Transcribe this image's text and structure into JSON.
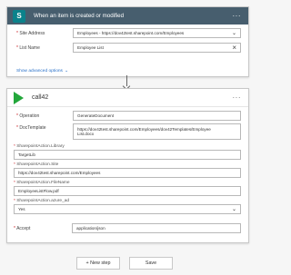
{
  "trigger": {
    "title": "When an item is created or modified",
    "more_icon": "···",
    "fields": [
      {
        "label": "Site Address",
        "value": "Employees - https://dov42test.sharepoint.com/Employees",
        "control": "chevron-down-icon"
      },
      {
        "label": "List Name",
        "value": "Employee List",
        "control": "close-icon"
      }
    ],
    "show_advanced": "Show advanced options",
    "show_advanced_chevron": "⌄"
  },
  "action": {
    "title": "call42",
    "more_icon": "···",
    "fields": [
      {
        "label": "Operation",
        "value": "GenerateDocument"
      },
      {
        "label": "DocTemplate",
        "value_line1": "https://dov42test.sharepoint.com/Employees/dov42Templates/Employee",
        "value_line2": "List.docx"
      }
    ],
    "stacked": [
      {
        "label": "SharepointAction.Library",
        "value": "TargetLib"
      },
      {
        "label": "SharepointAction.Site",
        "value": "https://dov42test.sharepoint.com/Employees"
      },
      {
        "label": "SharepointAction.FileName",
        "value": "EmployeeListFlow.pdf"
      },
      {
        "label": "SharepointAction.azure_ad",
        "value": "Yes"
      }
    ],
    "accept": {
      "label": "Accept",
      "value": "application/json"
    }
  },
  "footer": {
    "new_step": "+ New step",
    "save": "Save"
  },
  "colors": {
    "trigger_header": "#475e6e",
    "sharepoint": "#0b828b",
    "play": "#23a73b",
    "link": "#2870c8",
    "required": "#c8191e"
  }
}
